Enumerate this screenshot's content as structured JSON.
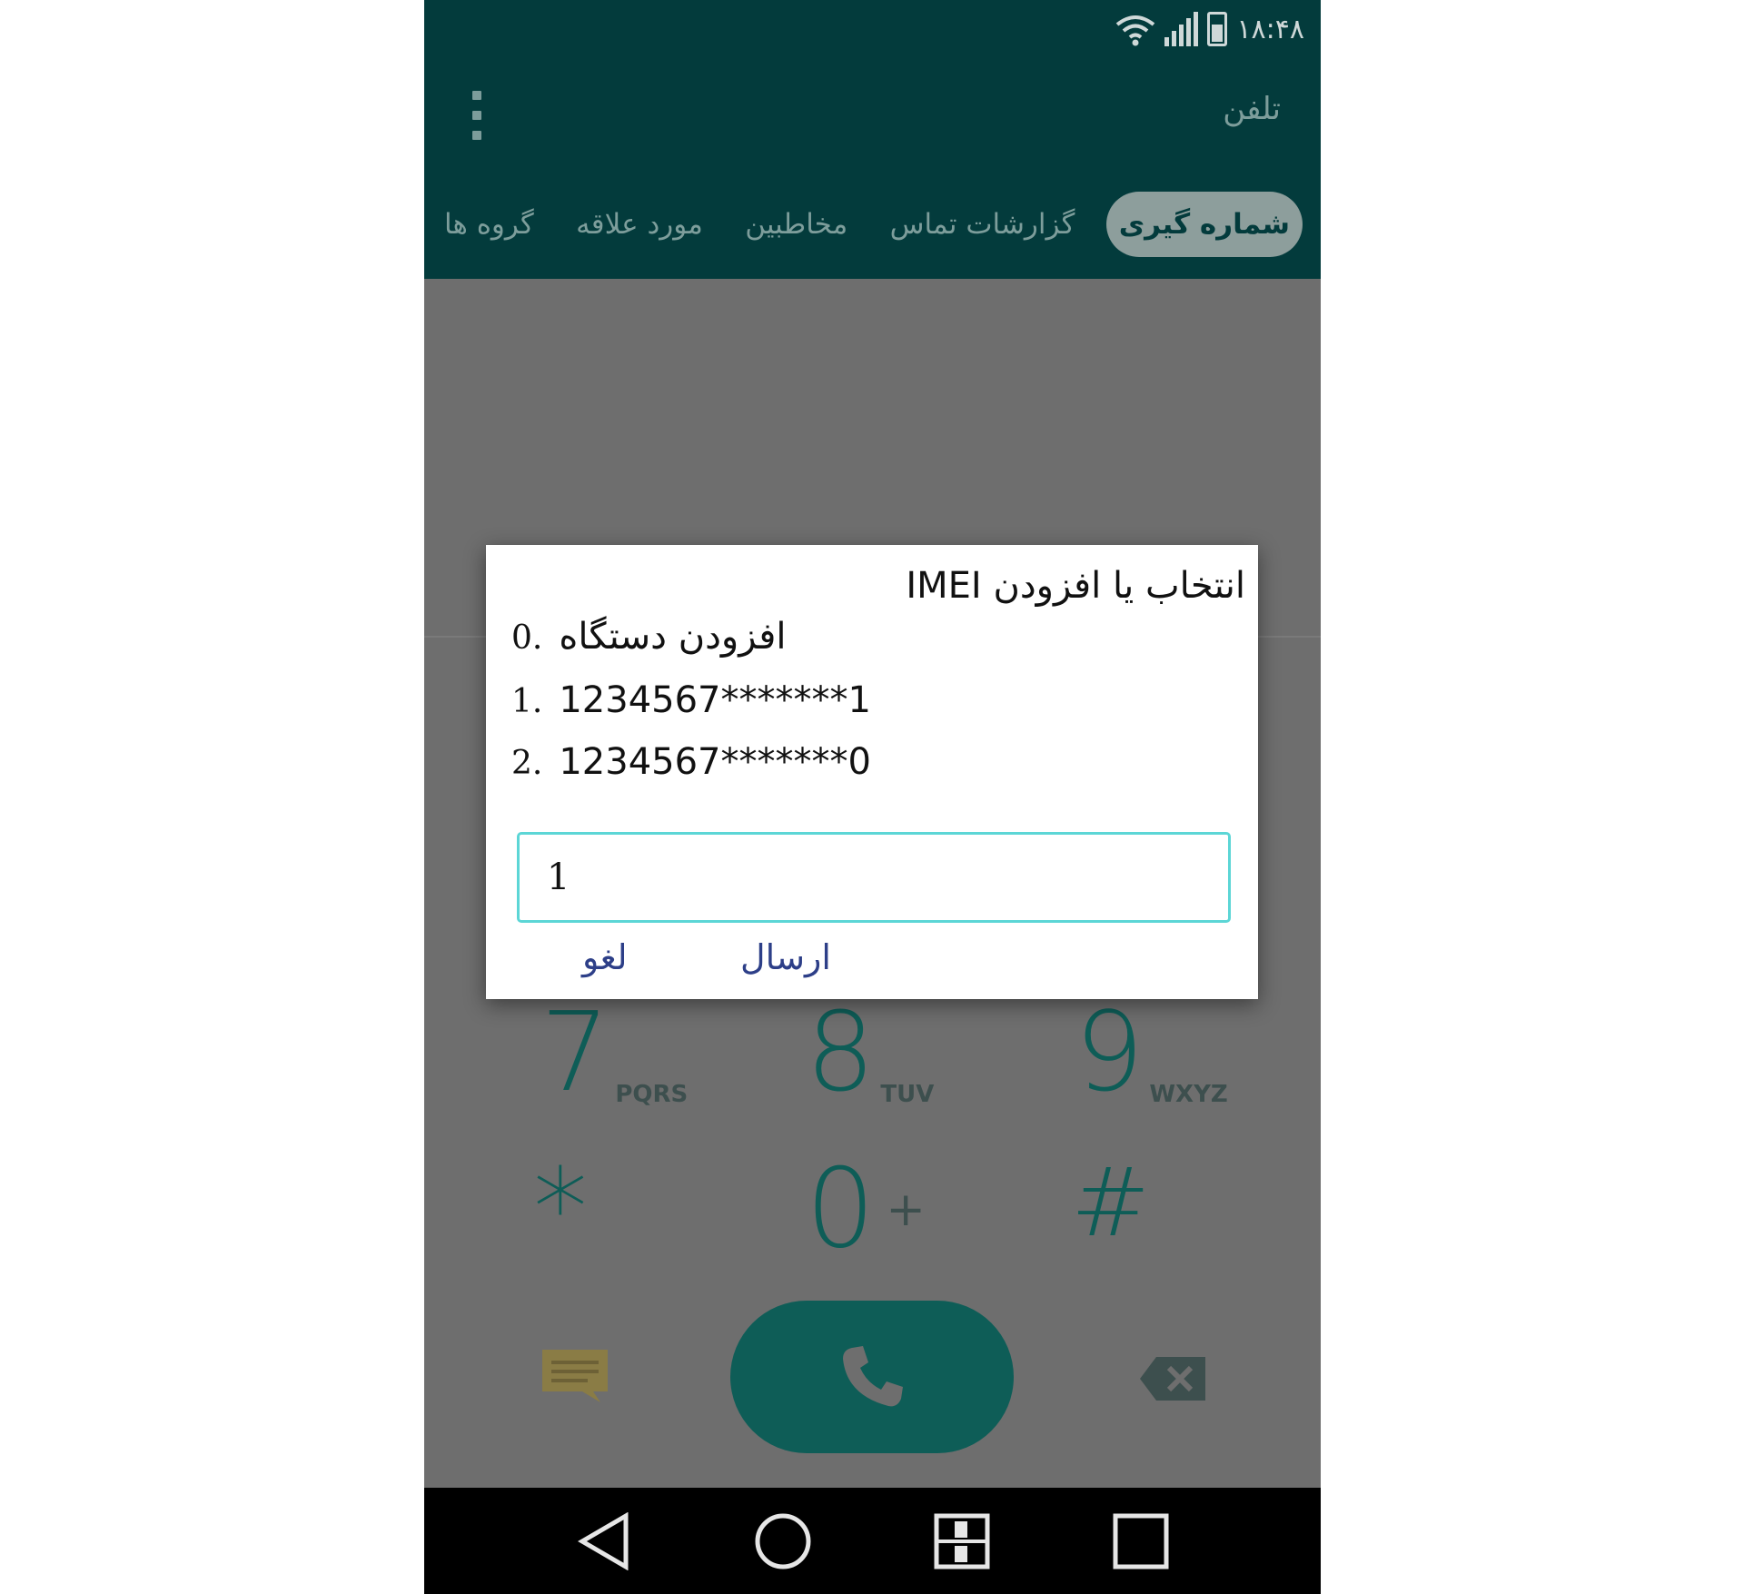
{
  "status_bar": {
    "time": "۱۸:۴۸",
    "icons": [
      "wifi-icon",
      "signal-icon",
      "battery-icon"
    ]
  },
  "app_bar": {
    "title": "تلفن",
    "overflow_icon": "more-vertical-icon"
  },
  "tabs": [
    {
      "label": "گروه ها",
      "active": false
    },
    {
      "label": "مورد علاقه",
      "active": false
    },
    {
      "label": "مخاطبین",
      "active": false
    },
    {
      "label": "گزارشات تماس",
      "active": false
    },
    {
      "label": "شماره گیری",
      "active": true
    }
  ],
  "dialpad": {
    "keys": [
      {
        "digit": "7",
        "letters": "PQRS"
      },
      {
        "digit": "8",
        "letters": "TUV"
      },
      {
        "digit": "9",
        "letters": "WXYZ"
      },
      {
        "digit": "*",
        "letters": ""
      },
      {
        "digit": "0",
        "letters": "+"
      },
      {
        "digit": "#",
        "letters": ""
      }
    ],
    "message_icon": "message-icon",
    "call_icon": "phone-icon",
    "delete_icon": "backspace-icon"
  },
  "dialog": {
    "title": "انتخاب یا افزودن IMEI",
    "options": [
      {
        "index": "0.",
        "text": "افزودن دستگاه"
      },
      {
        "index": "1.",
        "text": "1234567*******1"
      },
      {
        "index": "2.",
        "text": "1234567*******0"
      }
    ],
    "input_value": "1",
    "cancel_label": "لغو",
    "send_label": "ارسال"
  },
  "colors": {
    "app_bar": "#033b3c",
    "scrim": "#6e6e6e",
    "accent": "#0e5d57",
    "input_border": "#5cd6d6",
    "dialog_button": "#2d3f88"
  },
  "nav_bar": {
    "icons": [
      "back-icon",
      "home-icon",
      "dual-window-icon",
      "recents-icon"
    ]
  }
}
